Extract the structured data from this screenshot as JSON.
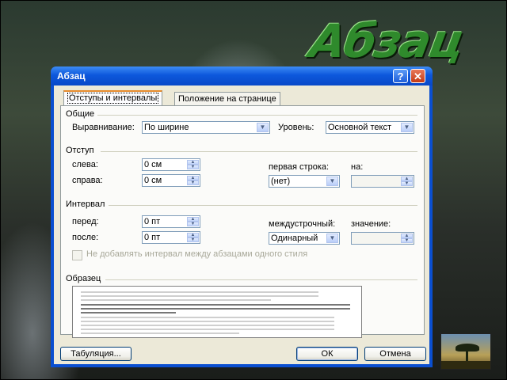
{
  "slide": {
    "title": "Абзац"
  },
  "dialog": {
    "title": "Абзац",
    "help_label": "?",
    "close_label": "✕",
    "tabs": [
      {
        "label": "Отступы и интервалы",
        "active": true
      },
      {
        "label": "Положение на странице",
        "active": false
      }
    ],
    "general": {
      "group_label": "Общие",
      "alignment_label": "Выравнивание:",
      "alignment_value": "По ширине",
      "level_label": "Уровень:",
      "level_value": "Основной текст"
    },
    "indent": {
      "group_label": "Отступ",
      "left_label": "слева:",
      "left_value": "0 см",
      "right_label": "справа:",
      "right_value": "0 см",
      "first_line_label": "первая строка:",
      "first_line_value": "(нет)",
      "by_label": "на:",
      "by_value": ""
    },
    "spacing": {
      "group_label": "Интервал",
      "before_label": "перед:",
      "before_value": "0 пт",
      "after_label": "после:",
      "after_value": "0 пт",
      "line_spacing_label": "междустрочный:",
      "line_spacing_value": "Одинарный",
      "at_label": "значение:",
      "at_value": "",
      "no_space_checkbox_label": "Не добавлять интервал между абзацами одного стиля",
      "no_space_checked": false
    },
    "preview": {
      "group_label": "Образец"
    },
    "buttons": {
      "tabs_label": "Табуляция...",
      "ok_label": "ОК",
      "cancel_label": "Отмена"
    }
  },
  "colors": {
    "titlebar": "#0d58dc",
    "dialog_bg": "#ece9d8",
    "slide_title": "#2f8a2c"
  }
}
